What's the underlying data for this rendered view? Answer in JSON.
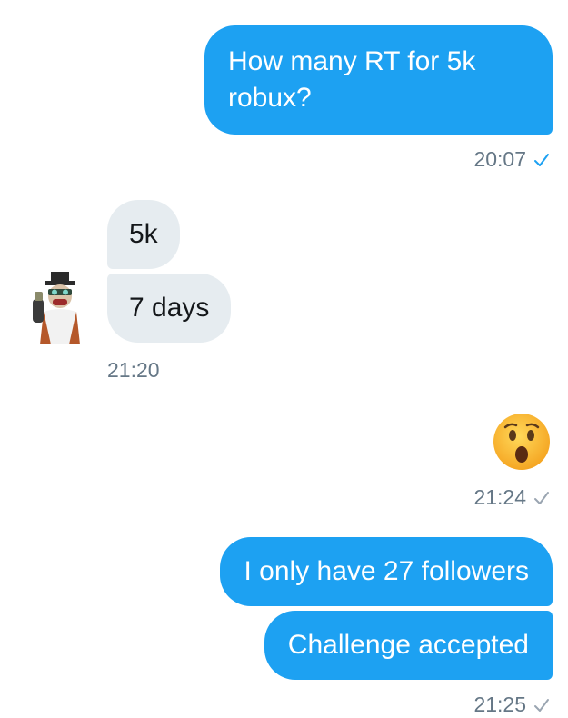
{
  "conversation": {
    "messages": [
      {
        "side": "out",
        "text": "How many RT for 5k robux?"
      },
      {
        "side": "in",
        "text": "5k"
      },
      {
        "side": "in",
        "text": "7 days"
      },
      {
        "side": "out",
        "emoji": "hushed-face-emoji"
      },
      {
        "side": "out",
        "text": "I only have 27 followers"
      },
      {
        "side": "out",
        "text": "Challenge accepted"
      }
    ],
    "timestamps": [
      {
        "time": "20:07",
        "status": "read",
        "check_color": "#1da1f2"
      },
      {
        "time": "21:20"
      },
      {
        "time": "21:24",
        "status": "sent",
        "check_color": "#9aa5b1"
      },
      {
        "time": "21:25",
        "status": "sent",
        "check_color": "#9aa5b1"
      }
    ]
  },
  "colors": {
    "outgoing_bubble": "#1da1f2",
    "incoming_bubble": "#e6ecf0",
    "timestamp_text": "#657786"
  },
  "icons": [
    "user-avatar",
    "hushed-face-emoji",
    "checkmark-icon"
  ]
}
